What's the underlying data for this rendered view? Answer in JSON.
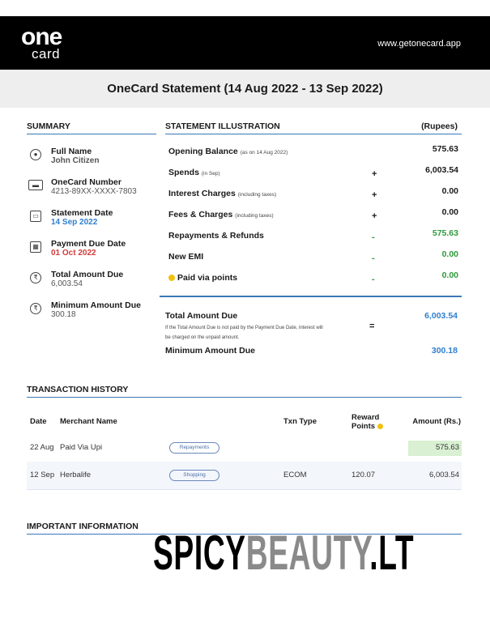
{
  "header": {
    "logo_top": "one",
    "logo_bottom": "card",
    "website": "www.getonecard.app"
  },
  "title": "OneCard Statement (14 Aug 2022 - 13 Sep 2022)",
  "summary": {
    "heading": "SUMMARY",
    "items": [
      {
        "label": "Full Name",
        "value": "John Citizen",
        "icon": "user-icon"
      },
      {
        "label": "OneCard Number",
        "value": "4213-89XX-XXXX-7803",
        "icon": "card-icon"
      },
      {
        "label": "Statement Date",
        "value": "14 Sep 2022",
        "icon": "calendar-icon"
      },
      {
        "label": "Payment Due Date",
        "value": "01 Oct 2022",
        "icon": "calendar-due-icon"
      },
      {
        "label": "Total Amount Due",
        "value": "6,003.54",
        "icon": "rupee-icon"
      },
      {
        "label": "Minimum Amount Due",
        "value": "300.18",
        "icon": "rupee-icon"
      }
    ]
  },
  "illustration": {
    "heading": "STATEMENT ILLUSTRATION",
    "unit": "(Rupees)",
    "rows": [
      {
        "label": "Opening Balance",
        "note": "(as on 14 Aug 2022)",
        "op": "",
        "amount": "575.63"
      },
      {
        "label": "Spends",
        "note": "(in Sep)",
        "op": "+",
        "amount": "6,003.54"
      },
      {
        "label": "Interest Charges",
        "note": "(including taxes)",
        "op": "+",
        "amount": "0.00"
      },
      {
        "label": "Fees & Charges",
        "note": "(including taxes)",
        "op": "+",
        "amount": "0.00"
      },
      {
        "label": "Repayments & Refunds",
        "note": "",
        "op": "-",
        "amount": "575.63"
      },
      {
        "label": "New EMI",
        "note": "",
        "op": "-",
        "amount": "0.00"
      },
      {
        "label": "Paid via points",
        "note": "",
        "op": "-",
        "amount": "0.00"
      }
    ],
    "total_label": "Total Amount Due",
    "total_note": "If the Total Amount Due is not paid by the Payment Due Date, interest will be charged on the unpaid amount.",
    "total_op": "=",
    "total_amount": "6,003.54",
    "min_label": "Minimum Amount Due",
    "min_amount": "300.18"
  },
  "transactions": {
    "heading": "TRANSACTION HISTORY",
    "columns": {
      "date": "Date",
      "merchant": "Merchant Name",
      "type": "Txn Type",
      "points": "Reward Points",
      "amount": "Amount (Rs.)"
    },
    "rows": [
      {
        "date": "22 Aug",
        "merchant": "Paid Via Upi",
        "category": "Repayments",
        "type": "",
        "points": "",
        "amount": "575.63"
      },
      {
        "date": "12 Sep",
        "merchant": "Herbalife",
        "category": "Shopping",
        "type": "ECOM",
        "points": "120.07",
        "amount": "6,003.54"
      }
    ]
  },
  "important": {
    "heading": "IMPORTANT INFORMATION"
  },
  "watermark": {
    "part1": "SPICY",
    "part2": "BEAUTY",
    "part3": ".LT"
  },
  "colors": {
    "accent_blue": "#2f7fcf",
    "green": "#2e9a3a",
    "red": "#d43a3a",
    "rule": "#3b78b8"
  }
}
